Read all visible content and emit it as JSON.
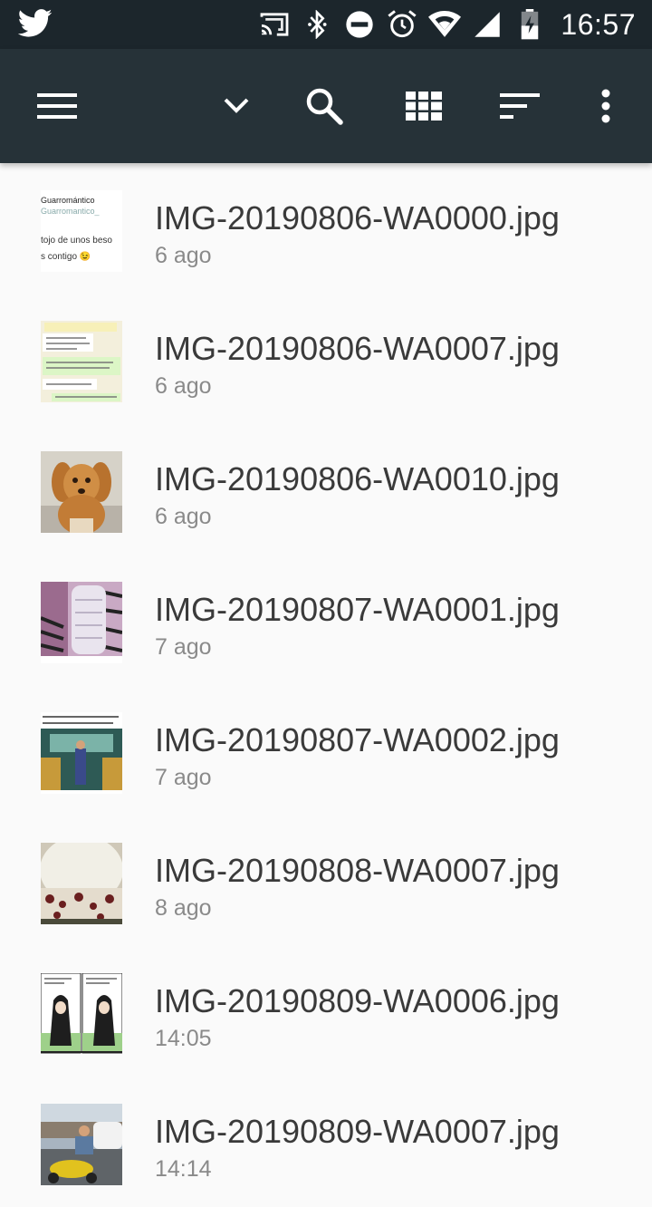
{
  "status_bar": {
    "time": "16:57",
    "icons": [
      "twitter-icon",
      "cast-icon",
      "bluetooth-icon",
      "do-not-disturb-icon",
      "alarm-icon",
      "wifi-icon",
      "signal-icon",
      "battery-charging-icon"
    ]
  },
  "toolbar": {
    "icons": [
      "menu-icon",
      "chevron-down-icon",
      "search-icon",
      "grid-view-icon",
      "sort-icon",
      "more-vert-icon"
    ]
  },
  "colors": {
    "statusbar": "#1c262c",
    "toolbar": "#263238",
    "background": "#fafafa",
    "title_text": "#3a3a3a",
    "subtitle_text": "#8a8a8a"
  },
  "files": [
    {
      "name": "IMG-20190806-WA0000.jpg",
      "date": "6 ago",
      "thumb_text": [
        "Guarromántico",
        "Guarromantico_",
        "tojo de unos beso",
        "s contigo 😉"
      ]
    },
    {
      "name": "IMG-20190806-WA0007.jpg",
      "date": "6 ago"
    },
    {
      "name": "IMG-20190806-WA0010.jpg",
      "date": "6 ago"
    },
    {
      "name": "IMG-20190807-WA0001.jpg",
      "date": "7 ago"
    },
    {
      "name": "IMG-20190807-WA0002.jpg",
      "date": "7 ago"
    },
    {
      "name": "IMG-20190808-WA0007.jpg",
      "date": "8 ago"
    },
    {
      "name": "IMG-20190809-WA0006.jpg",
      "date": "14:05"
    },
    {
      "name": "IMG-20190809-WA0007.jpg",
      "date": "14:14"
    }
  ]
}
